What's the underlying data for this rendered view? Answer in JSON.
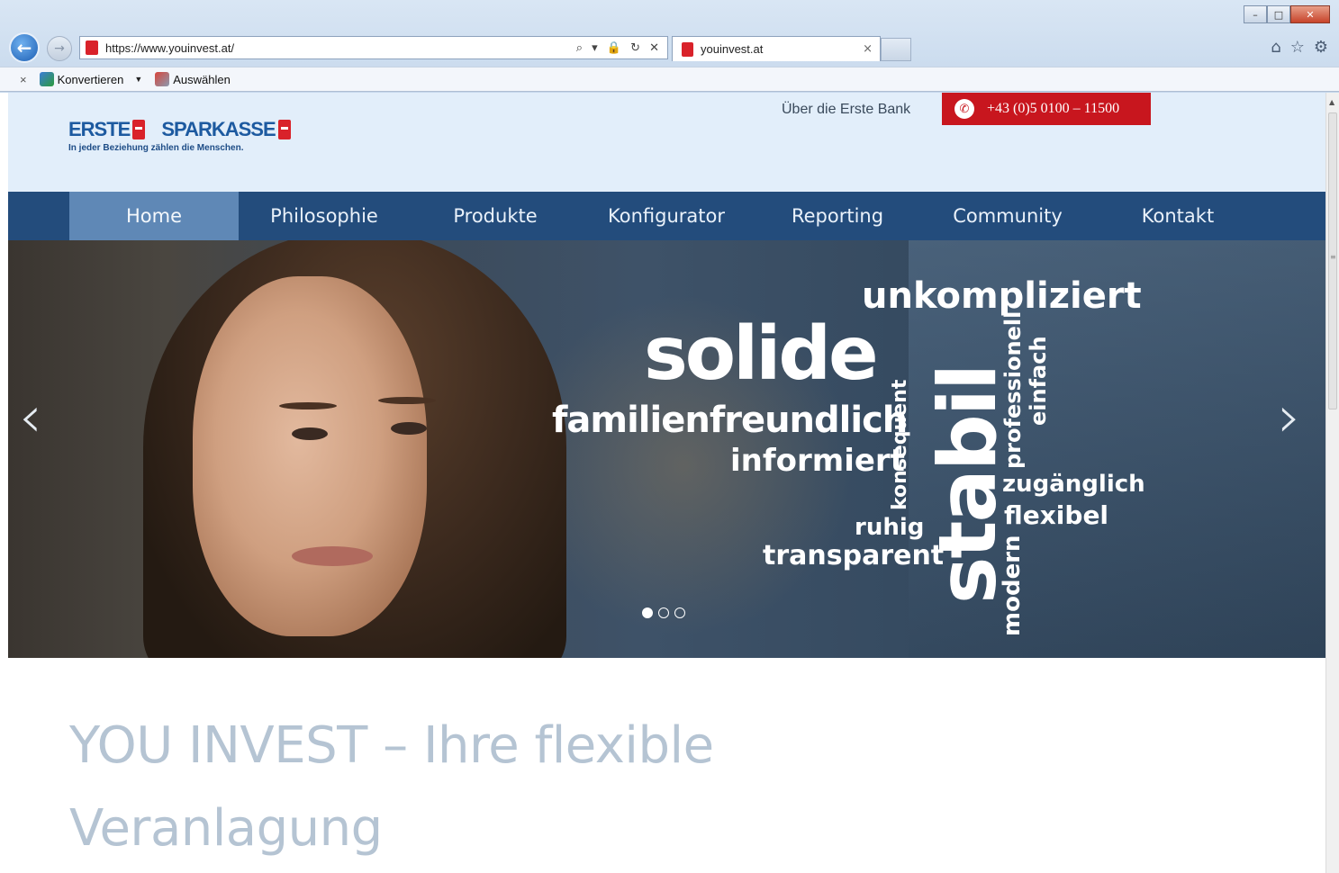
{
  "browser": {
    "address_url": "https://www.youinvest.at/",
    "tab_title": "youinvest.at",
    "tab_close": "×",
    "address_icons": "⌕ ▾ 🔒 ↻ ✕",
    "window_buttons": {
      "minimize": "–",
      "maximize": "□",
      "close": "✕"
    },
    "right_icons": {
      "home": "⌂",
      "favorites": "☆",
      "settings": "⚙"
    },
    "command_bar": {
      "close": "×",
      "convert_label": "Konvertieren",
      "dropdown": "▼",
      "select_label": "Auswählen"
    }
  },
  "header": {
    "logo_left": "ERSTE",
    "logo_right": "SPARKASSE",
    "logo_tagline": "In jeder Beziehung zählen die Menschen.",
    "about_link": "Über die Erste Bank",
    "phone_label": "+43 (0)5 0100 – 11500",
    "phone_icon": "✆",
    "brand_color": "#1d5aa0",
    "accent_red": "#c8161e"
  },
  "nav": {
    "items": [
      {
        "label": "Home",
        "active": true
      },
      {
        "label": "Philosophie",
        "active": false
      },
      {
        "label": "Produkte",
        "active": false
      },
      {
        "label": "Konfigurator",
        "active": false
      },
      {
        "label": "Reporting",
        "active": false
      },
      {
        "label": "Community",
        "active": false
      },
      {
        "label": "Kontakt",
        "active": false
      }
    ]
  },
  "hero": {
    "words": {
      "unkompliziert": "unkompliziert",
      "solide": "solide",
      "stabil": "stabil",
      "professionell": "professionell",
      "einfach": "einfach",
      "familienfreundlich": "familienfreundlich",
      "konsequent": "konsequent",
      "informiert": "informiert",
      "zugaenglich": "zugänglich",
      "flexibel": "flexibel",
      "ruhig": "ruhig",
      "transparent": "transparent",
      "modern": "modern"
    },
    "prev_arrow": "‹",
    "next_arrow": "›",
    "slide_count": 3,
    "active_slide": 1
  },
  "main": {
    "headline_line1": "YOU INVEST – Ihre flexible",
    "headline_line2": "Veranlagung"
  }
}
